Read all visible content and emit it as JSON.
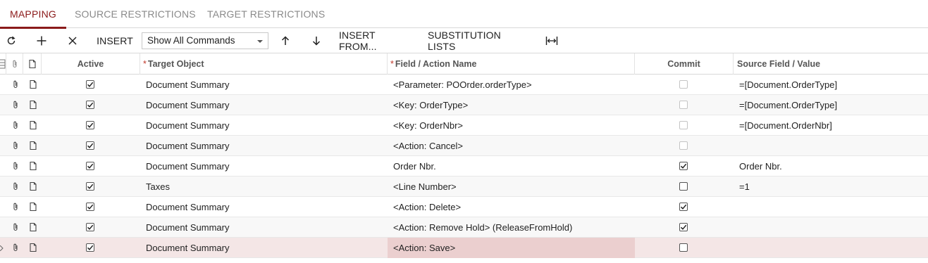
{
  "tabs": [
    {
      "label": "MAPPING",
      "active": true
    },
    {
      "label": "SOURCE RESTRICTIONS",
      "active": false
    },
    {
      "label": "TARGET RESTRICTIONS",
      "active": false
    }
  ],
  "toolbar": {
    "refresh_icon": "refresh-icon",
    "add_icon": "plus-icon",
    "delete_icon": "close-icon",
    "insert_label": "INSERT",
    "command_filter_value": "Show All Commands",
    "move_up_icon": "arrow-up-icon",
    "move_down_icon": "arrow-down-icon",
    "insert_from_label": "INSERT FROM...",
    "substitution_lists_label": "SUBSTITUTION LISTS",
    "fit_columns_icon": "fit-columns-icon"
  },
  "grid": {
    "columns": {
      "active": "Active",
      "target_object": "Target Object",
      "field_action_name": "Field / Action Name",
      "commit": "Commit",
      "source_field_value": "Source Field / Value"
    },
    "rows": [
      {
        "active": true,
        "target_object": "Document Summary",
        "field": "<Parameter: POOrder.orderType>",
        "commit": false,
        "commit_enabled": false,
        "source": "=[Document.OrderType]"
      },
      {
        "active": true,
        "target_object": "Document Summary",
        "field": "<Key: OrderType>",
        "commit": false,
        "commit_enabled": false,
        "source": "=[Document.OrderType]"
      },
      {
        "active": true,
        "target_object": "Document Summary",
        "field": "<Key: OrderNbr>",
        "commit": false,
        "commit_enabled": false,
        "source": "=[Document.OrderNbr]"
      },
      {
        "active": true,
        "target_object": "Document Summary",
        "field": "<Action: Cancel>",
        "commit": false,
        "commit_enabled": false,
        "source": ""
      },
      {
        "active": true,
        "target_object": "Document Summary",
        "field": "Order Nbr.",
        "commit": true,
        "commit_enabled": true,
        "source": "Order Nbr."
      },
      {
        "active": true,
        "target_object": "Taxes",
        "field": "<Line Number>",
        "commit": false,
        "commit_enabled": true,
        "source": "=1"
      },
      {
        "active": true,
        "target_object": "Document Summary",
        "field": "<Action: Delete>",
        "commit": true,
        "commit_enabled": true,
        "source": ""
      },
      {
        "active": true,
        "target_object": "Document Summary",
        "field": "<Action: Remove Hold> (ReleaseFromHold)",
        "commit": true,
        "commit_enabled": true,
        "source": ""
      },
      {
        "active": true,
        "target_object": "Document Summary",
        "field": "<Action: Save>",
        "commit": false,
        "commit_enabled": true,
        "source": "",
        "selected": true
      }
    ]
  },
  "colors": {
    "accent": "#8b1a1a",
    "selected_row": "#f4e6e6",
    "active_cell": "#ebcfcf",
    "required_marker": "#c0392b"
  }
}
